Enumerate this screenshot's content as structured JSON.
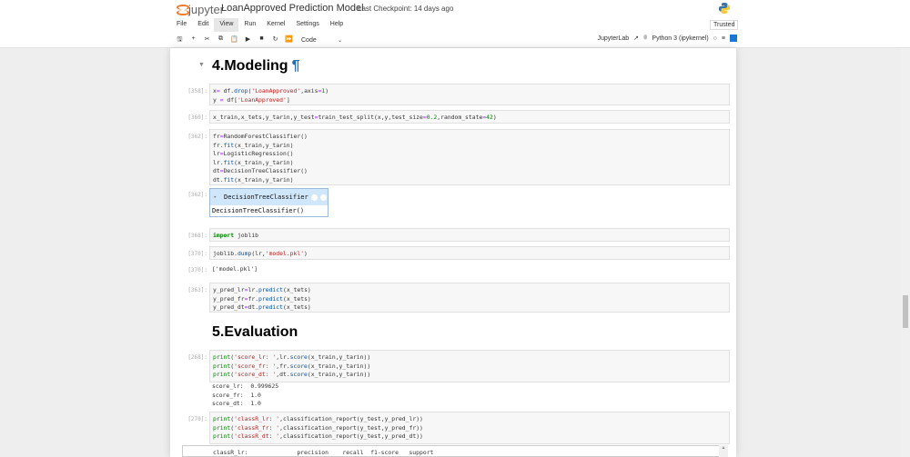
{
  "header": {
    "logo": "jupyter",
    "title": "LoanApproved Prediction Model",
    "checkpoint": "Last Checkpoint: 14 days ago",
    "trusted": "Trusted"
  },
  "menu": [
    "File",
    "Edit",
    "View",
    "Run",
    "Kernel",
    "Settings",
    "Help"
  ],
  "toolbar": {
    "icons": [
      "save-icon",
      "plus-icon",
      "cut-icon",
      "copy-icon",
      "paste-icon",
      "run-icon",
      "stop-icon",
      "restart-icon",
      "fast-forward-icon"
    ],
    "glyphs": [
      "🖫",
      "+",
      "✂",
      "⧉",
      "📋",
      "▶",
      "■",
      "↻",
      "⏩"
    ],
    "cell_type": "Code",
    "jupyterlab": "JupyterLab",
    "kernel": "Python 3 (ipykernel)"
  },
  "headings": {
    "modeling": "4.Modeling",
    "evaluation": "5.Evaluation",
    "anchor": "¶"
  },
  "cells": [
    {
      "prompt": "[358]:",
      "lines": [
        [
          [
            "x",
            "t"
          ],
          [
            "=",
            "o"
          ],
          [
            " df.",
            "t"
          ],
          [
            "drop",
            "m"
          ],
          [
            "(",
            "t"
          ],
          [
            "'LoanApproved'",
            "s"
          ],
          [
            ",axis",
            "t"
          ],
          [
            "=",
            "o"
          ],
          [
            "1",
            "n"
          ],
          [
            ")",
            "t"
          ]
        ],
        [
          [
            "y ",
            "t"
          ],
          [
            "=",
            "o"
          ],
          [
            " df[",
            "t"
          ],
          [
            "'LoanApproved'",
            "s"
          ],
          [
            "]",
            "t"
          ]
        ]
      ]
    },
    {
      "prompt": "[360]:",
      "lines": [
        [
          [
            "x_train,x_tets,y_tarin,y_test",
            "t"
          ],
          [
            "=",
            "o"
          ],
          [
            "train_test_split(x,y,test_size",
            "t"
          ],
          [
            "=",
            "o"
          ],
          [
            "0.2",
            "n"
          ],
          [
            ",random_state",
            "t"
          ],
          [
            "=",
            "o"
          ],
          [
            "42",
            "n"
          ],
          [
            ")",
            "t"
          ]
        ]
      ]
    },
    {
      "prompt": "[362]:",
      "lines": [
        [
          [
            "fr",
            "t"
          ],
          [
            "=",
            "o"
          ],
          [
            "RandomForestClassifier()",
            "t"
          ]
        ],
        [
          [
            "fr.",
            "t"
          ],
          [
            "fit",
            "m"
          ],
          [
            "(x_train,y_tarin)",
            "t"
          ]
        ],
        [
          [
            "lr",
            "t"
          ],
          [
            "=",
            "o"
          ],
          [
            "LogisticRegression()",
            "t"
          ]
        ],
        [
          [
            "lr.",
            "t"
          ],
          [
            "fit",
            "m"
          ],
          [
            "(x_train,y_tarin)",
            "t"
          ]
        ],
        [
          [
            "dt",
            "t"
          ],
          [
            "=",
            "o"
          ],
          [
            "DecisionTreeClassifier()",
            "t"
          ]
        ],
        [
          [
            "dt.",
            "t"
          ],
          [
            "fit",
            "m"
          ],
          [
            "(x_train,y_tarin)",
            "t"
          ]
        ]
      ]
    },
    {
      "prompt": "[368]:",
      "lines": [
        [
          [
            "import",
            "k"
          ],
          [
            " joblib",
            "t"
          ]
        ]
      ]
    },
    {
      "prompt": "[370]:",
      "lines": [
        [
          [
            "joblib.",
            "t"
          ],
          [
            "dump",
            "m"
          ],
          [
            "(lr,",
            "t"
          ],
          [
            "'model.pkl'",
            "s"
          ],
          [
            ")",
            "t"
          ]
        ]
      ]
    },
    {
      "prompt": "[363]:",
      "lines": [
        [
          [
            "y_pred_lr",
            "t"
          ],
          [
            "=",
            "o"
          ],
          [
            "lr.",
            "t"
          ],
          [
            "predict",
            "m"
          ],
          [
            "(x_tets)",
            "t"
          ]
        ],
        [
          [
            "y_pred_fr",
            "t"
          ],
          [
            "=",
            "o"
          ],
          [
            "fr.",
            "t"
          ],
          [
            "predict",
            "m"
          ],
          [
            "(x_tets)",
            "t"
          ]
        ],
        [
          [
            "y_pred_dt",
            "t"
          ],
          [
            "=",
            "o"
          ],
          [
            "dt.",
            "t"
          ],
          [
            "predict",
            "m"
          ],
          [
            "(x_tets)",
            "t"
          ]
        ]
      ]
    },
    {
      "prompt": "[268]:",
      "lines": [
        [
          [
            "print",
            "n"
          ],
          [
            "(",
            "t"
          ],
          [
            "'score_lr: '",
            "s"
          ],
          [
            ",lr.",
            "t"
          ],
          [
            "score",
            "m"
          ],
          [
            "(x_train,y_tarin))",
            "t"
          ]
        ],
        [
          [
            "print",
            "n"
          ],
          [
            "(",
            "t"
          ],
          [
            "'score_fr: '",
            "s"
          ],
          [
            ",fr.",
            "t"
          ],
          [
            "score",
            "m"
          ],
          [
            "(x_train,y_tarin))",
            "t"
          ]
        ],
        [
          [
            "print",
            "n"
          ],
          [
            "(",
            "t"
          ],
          [
            "'score_dt: '",
            "s"
          ],
          [
            ",dt.",
            "t"
          ],
          [
            "score",
            "m"
          ],
          [
            "(x_train,y_tarin))",
            "t"
          ]
        ]
      ]
    },
    {
      "prompt": "[270]:",
      "lines": [
        [
          [
            "print",
            "n"
          ],
          [
            "(",
            "t"
          ],
          [
            "'classR_lr: '",
            "s"
          ],
          [
            ",classification_report(y_test,y_pred_lr))",
            "t"
          ]
        ],
        [
          [
            "print",
            "n"
          ],
          [
            "(",
            "t"
          ],
          [
            "'classR_fr: '",
            "s"
          ],
          [
            ",classification_report(y_test,y_pred_fr))",
            "t"
          ]
        ],
        [
          [
            "print",
            "n"
          ],
          [
            "(",
            "t"
          ],
          [
            "'classR_dt: '",
            "s"
          ],
          [
            ",classification_report(y_test,y_pred_dt))",
            "t"
          ]
        ]
      ]
    }
  ],
  "outputs": {
    "widget_prompt": "[362]:",
    "widget_title": "DecisionTreeClassifier",
    "widget_body": "DecisionTreeClassifier()",
    "joblib_prompt": "[370]:",
    "joblib_result": "['model.pkl']",
    "scores": "score_lr:  0.999625\nscore_fr:  1.0\nscore_dt:  1.0",
    "report_header": "classR_lr:              precision    recall  f1-score   support"
  }
}
